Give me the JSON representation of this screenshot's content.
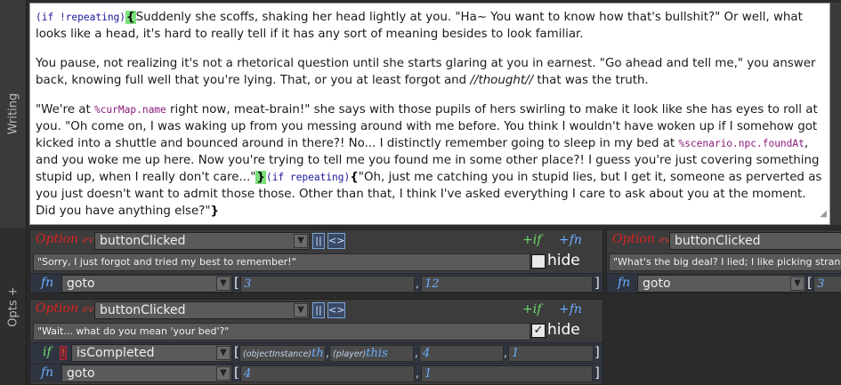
{
  "side": {
    "writing": "Writing",
    "opts": "Opts +"
  },
  "writing": {
    "p1": {
      "cond": "(if !repeating)",
      "brace_open": "{",
      "text": "Suddenly she scoffs, shaking her head lightly at you. \"Ha~ You want to know how that's bullshit?\" Or well, what looks like a head, it's hard to really tell if it has any sort of meaning besides to look familiar."
    },
    "p2": {
      "text_a": "You pause, not realizing it's not a rhetorical question until she starts glaring at you in earnest. \"Go ahead and tell me,\" you answer back, knowing full well that you're lying. That, or you at least forgot and ",
      "italic": "//thought//",
      "text_b": " that was the truth."
    },
    "p3": {
      "t1": "\"We're at ",
      "v1": "%curMap.name",
      "t2": " right now, meat-brain!\" she says with those pupils of hers swirling to make it look like she has eyes to roll at you. \"Oh come on, I was waking up from you messing around with me before. You think I wouldn't have woken up if I somehow got kicked into a shuttle and bounced around in there?! No... I distinctly remember going to sleep in my bed at ",
      "v2": "%scenario.npc.foundAt",
      "t3": ", and you woke me up here. Now you're trying to tell me you found me in some other place?! I guess you're just covering something stupid up, when I really don't care...\"",
      "brace_close": "}",
      "cond2": "(if repeating)",
      "brace_open2": "{",
      "t4": "\"Oh, just me catching you in stupid lies, but I get it, someone as perverted as you just doesn't want to admit those those. Other than that, I think I've asked everything I care to ask about you at the moment. Did you have anything else?\"",
      "brace_close2": "}"
    }
  },
  "options": [
    {
      "option_label": "Option",
      "option_sub": "ev",
      "event": "buttonClicked",
      "pipe_btn": "||",
      "swap_btn": "<>",
      "plus_if": "+if",
      "plus_fn": "+fn",
      "text": "\"Sorry, I just forgot and tried my best to remember!\"",
      "hide_label": "hide",
      "hide_checked": false,
      "fn_kw": "fn",
      "fn_name": "goto",
      "args": [
        "3",
        "12"
      ]
    },
    {
      "option_label": "Option",
      "option_sub": "ev",
      "event": "buttonClicked",
      "pipe_btn": "||",
      "swap_btn": "<>",
      "plus_if": "+if",
      "plus_fn": "+fn",
      "text": "\"Wait... what do you mean 'your bed'?\"",
      "hide_label": "hide",
      "hide_checked": true,
      "check_mark": "✓",
      "if_kw": "if",
      "if_neg": "!",
      "if_name": "isCompleted",
      "if_args": [
        {
          "type": "(objectInstance)",
          "value": "th"
        },
        {
          "type": "(player)",
          "value": "this"
        },
        {
          "type": "",
          "value": "4"
        },
        {
          "type": "",
          "value": "1"
        }
      ],
      "fn_kw": "fn",
      "fn_name": "goto",
      "args": [
        "4",
        "1"
      ]
    },
    {
      "option_label": "Option",
      "option_sub": "ev",
      "event": "buttonClicked",
      "text": "\"What's the big deal? I lied; I like picking strange t",
      "fn_kw": "fn",
      "fn_name": "goto",
      "args": [
        "3"
      ]
    }
  ],
  "colors": {
    "option_label": "#dd2222",
    "if_green": "#6ddc6d",
    "fn_blue": "#6aaeff",
    "brace_highlight": "#7be07b"
  }
}
